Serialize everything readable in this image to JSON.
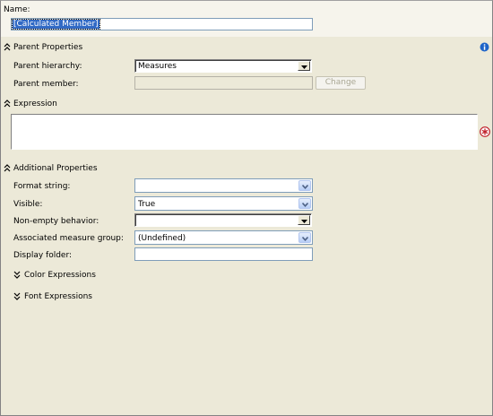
{
  "name": {
    "label": "Name:",
    "value": "[Calculated Member]"
  },
  "parent_properties": {
    "title": "Parent Properties",
    "info_icon": "info-icon",
    "hierarchy_label": "Parent hierarchy:",
    "hierarchy_value": "Measures",
    "member_label": "Parent member:",
    "member_value": "",
    "change_button": "Change"
  },
  "expression": {
    "title": "Expression",
    "value": "",
    "error_icon": "error-asterisk-icon"
  },
  "additional_properties": {
    "title": "Additional Properties",
    "format_string_label": "Format string:",
    "format_string_value": "",
    "visible_label": "Visible:",
    "visible_value": "True",
    "non_empty_label": "Non-empty behavior:",
    "non_empty_value": "",
    "measure_group_label": "Associated measure group:",
    "measure_group_value": "(Undefined)",
    "display_folder_label": "Display folder:",
    "display_folder_value": "",
    "color_expressions": "Color Expressions",
    "font_expressions": "Font Expressions"
  },
  "colors": {
    "accent_blue": "#316ac5",
    "info_blue": "#1e64c8",
    "error_red": "#c0202a"
  }
}
